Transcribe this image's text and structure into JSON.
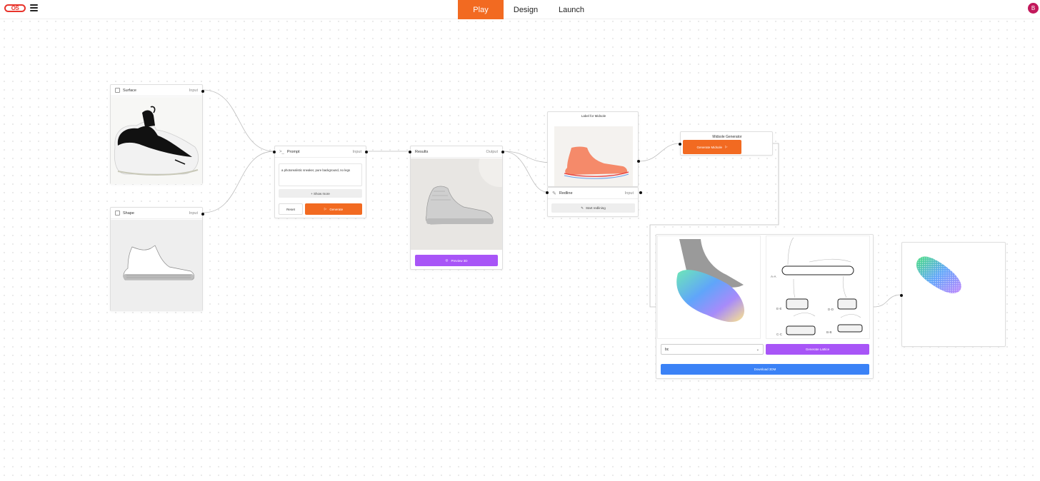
{
  "topbar": {
    "logo_text": "OS",
    "tabs": [
      {
        "label": "Play",
        "active": true
      },
      {
        "label": "Design",
        "active": false
      },
      {
        "label": "Launch",
        "active": false
      }
    ],
    "avatar_initial": "B"
  },
  "colors": {
    "accent_orange": "#f26a21",
    "accent_purple": "#a855f7",
    "accent_blue": "#3b82f6",
    "avatar": "#c2185b"
  },
  "nodes": {
    "surface": {
      "title": "Surface",
      "kind": "Input",
      "icon": "image-icon"
    },
    "shape": {
      "title": "Shape",
      "kind": "Input",
      "icon": "image-icon"
    },
    "prompt": {
      "title": "Prompt",
      "kind": "Input",
      "icon": "terminal-icon",
      "text": "a photorealistic sneaker, pure background, no legs",
      "show_more": "+ Show more",
      "reset": "Reset",
      "generate": "Generate"
    },
    "results": {
      "title": "Results",
      "kind": "Output",
      "preview": "Preview 3D"
    },
    "label_midsole": {
      "title": "Label for Midsole"
    },
    "redline": {
      "title": "Redline",
      "kind": "Input",
      "icon": "pencil-icon",
      "start": "Start redlining"
    },
    "midsole_generator": {
      "title": "Midsole Generator",
      "button": "Generate Midsole"
    },
    "lattice": {
      "select_value": "bc",
      "generate_lattice": "Generate Lattice",
      "download": "Download 3DM",
      "sections": [
        "A-A",
        "E-E",
        "D-D",
        "C-C",
        "B-B"
      ]
    }
  }
}
